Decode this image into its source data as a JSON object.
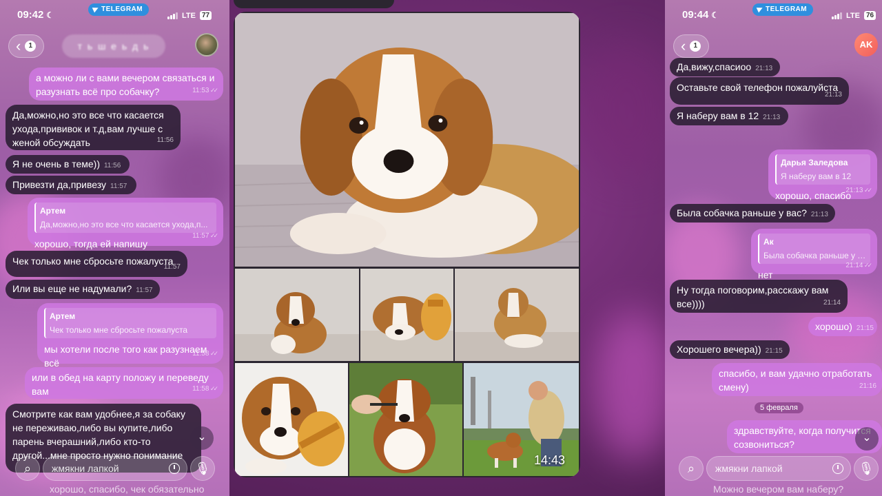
{
  "left_phone": {
    "status": {
      "time": "09:42",
      "network": "LTE",
      "battery": "77"
    },
    "telegram_label": "TELEGRAM",
    "back_count": "1",
    "title": "т ь ш е ь д ь",
    "messages": [
      {
        "dir": "out",
        "text": "а можно ли с вами вечером связаться и разузнать всё про собачку?",
        "time": "11:53"
      },
      {
        "dir": "in",
        "text": "Да,можно,но это все что касается ухода,прививок и т.д,вам лучше с женой обсуждать",
        "time": "11:56"
      },
      {
        "dir": "in",
        "text": "Я не очень в теме))",
        "time": "11:56"
      },
      {
        "dir": "in",
        "text": "Привезти да,привезу",
        "time": "11:57"
      },
      {
        "dir": "out",
        "reply_name": "Артем",
        "reply_text": "Да,можно,но это все что касается ухода,п...",
        "text": "хорошо, тогда ей напишу",
        "time": "11:57"
      },
      {
        "dir": "in",
        "text": "Чек только мне сбросьте пожалуста",
        "time": "11:57"
      },
      {
        "dir": "in",
        "text": "Или вы еще не надумали?",
        "time": "11:57"
      },
      {
        "dir": "out",
        "reply_name": "Артем",
        "reply_text": "Чек только мне сбросьте пожалуста",
        "text": "мы хотели после того как разузнаем всё",
        "time": "11:58"
      },
      {
        "dir": "out",
        "text": "или в обед на карту положу и переведу вам",
        "time": "11:58"
      },
      {
        "dir": "in",
        "text": "Смотрите как вам удобнее,я за собаку не переживаю,либо вы купите,либо парень вчерашний,либо кто-то другой...мне просто нужно понимание"
      }
    ],
    "input_placeholder": "жмякни лапкой",
    "ghost_text": "хорошо, спасибо, чек обязательно"
  },
  "album": {
    "time_label": "14:43"
  },
  "right_phone": {
    "status": {
      "time": "09:44",
      "network": "LTE",
      "battery": "76"
    },
    "telegram_label": "TELEGRAM",
    "back_count": "1",
    "avatar_initials": "AK",
    "messages": [
      {
        "dir": "in",
        "text": "Да,вижу,спасиоо",
        "time": "21:13"
      },
      {
        "dir": "in",
        "text": "Оставьте свой телефон пожалуйста",
        "time": "21:13"
      },
      {
        "dir": "in",
        "text": "Я наберу вам в 12",
        "time": "21:13"
      },
      {
        "dir": "out",
        "reply_name": "Дарья Заледова",
        "reply_text": "Я наберу вам в 12",
        "text": "хорошо, спасибо",
        "time": "21:13"
      },
      {
        "dir": "in",
        "text": "Была собачка раньше у вас?",
        "time": "21:13"
      },
      {
        "dir": "out",
        "reply_name": "Ак",
        "reply_text": "Была собачка раньше у вас?",
        "text": "нет",
        "time": "21:14"
      },
      {
        "dir": "in",
        "text": "Ну тогда поговорим,расскажу вам все))))",
        "time": "21:14"
      },
      {
        "dir": "out",
        "text": "хорошо)",
        "time": "21:15"
      },
      {
        "dir": "in",
        "text": "Хорошего вечера))",
        "time": "21:15"
      },
      {
        "dir": "out",
        "text": "спасибо, и вам удачно отработать смену)",
        "time": "21:16"
      },
      {
        "dir": "out",
        "text": "здравствуйте, когда получится созвониться?",
        "time": ""
      }
    ],
    "date_chip": "5 февраля",
    "input_placeholder": "жмякни лапкой",
    "ghost_text": "Можно вечером вам наберу?"
  },
  "colors": {
    "bubble_in": "#2a1c30",
    "bubble_out": "#ce78e0",
    "telegram_blue": "#2f8fde",
    "background": "#6a2a6d"
  }
}
